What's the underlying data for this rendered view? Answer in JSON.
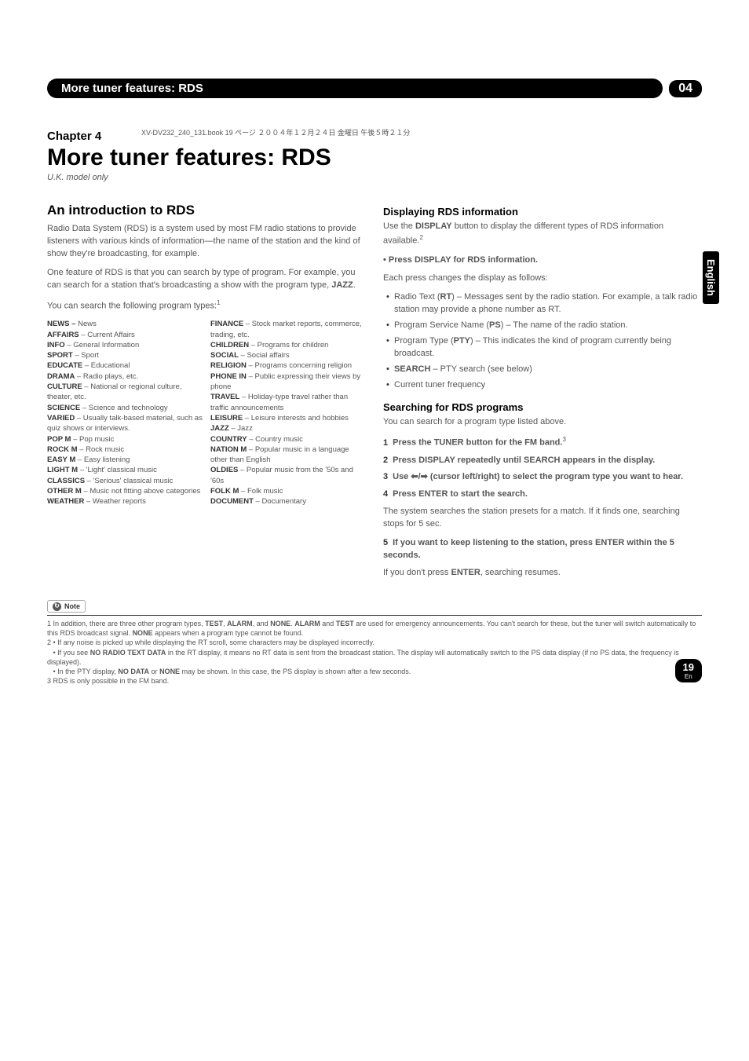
{
  "spine_note": "XV-DV232_240_131.book 19 ページ ２００４年１２月２４日 金曜日 午後５時２１分",
  "header": {
    "title": "More tuner features: RDS",
    "num": "04"
  },
  "side_tab": "English",
  "chapter": {
    "label": "Chapter 4",
    "title": "More tuner features: RDS",
    "subtitle": "U.K. model only"
  },
  "intro": {
    "heading": "An introduction to RDS",
    "p1": "Radio Data System (RDS) is a system used by most FM radio stations to provide listeners with various kinds of information—the name of the station and the kind of show they're broadcasting, for example.",
    "p2_a": "One feature of RDS is that you can search by type of program. For example, you can search for a station that's broadcasting a show with the program type, ",
    "p2_b": "JAZZ",
    "p2_c": ".",
    "p3": "You can search the following program types:",
    "sup1": "1"
  },
  "pt_left": {
    "news_k": "NEWS –",
    "news_v": " News",
    "affairs_k": "AFFAIRS",
    "affairs_v": " – Current Affairs",
    "info_k": "INFO",
    "info_v": " – General Information",
    "sport_k": "SPORT",
    "sport_v": " – Sport",
    "educate_k": "EDUCATE",
    "educate_v": " – Educational",
    "drama_k": "DRAMA",
    "drama_v": " – Radio plays, etc.",
    "culture_k": "CULTURE",
    "culture_v": " – National or regional culture, theater, etc.",
    "science_k": "SCIENCE",
    "science_v": " – Science and technology",
    "varied_k": "VARIED",
    "varied_v": " – Usually talk-based material, such as quiz shows or interviews.",
    "popm_k": "POP M",
    "popm_v": " – Pop music",
    "rockm_k": "ROCK M",
    "rockm_v": " – Rock music",
    "easym_k": "EASY M",
    "easym_v": " – Easy listening",
    "lightm_k": "LIGHT M",
    "lightm_v": " – 'Light' classical music",
    "classics_k": "CLASSICS",
    "classics_v": " – 'Serious' classical music",
    "otherm_k": "OTHER M",
    "otherm_v": " – Music not fitting above categories",
    "weather_k": "WEATHER",
    "weather_v": " – Weather reports"
  },
  "pt_right": {
    "finance_k": "FINANCE",
    "finance_v": " – Stock market reports, commerce, trading, etc.",
    "children_k": "CHILDREN",
    "children_v": " – Programs for children",
    "social_k": "SOCIAL",
    "social_v": " – Social affairs",
    "religion_k": "RELIGION",
    "religion_v": " – Programs concerning religion",
    "phonein_k": "PHONE IN",
    "phonein_v": " – Public expressing their views by phone",
    "travel_k": "TRAVEL",
    "travel_v": " – Holiday-type travel rather than traffic announcements",
    "leisure_k": "LEISURE",
    "leisure_v": " – Leisure interests and hobbies",
    "jazz_k": "JAZZ",
    "jazz_v": " – Jazz",
    "country_k": "COUNTRY",
    "country_v": " – Country music",
    "nationm_k": "NATION M",
    "nationm_v": " – Popular music in a language other than English",
    "oldies_k": "OLDIES",
    "oldies_v": " – Popular music from the '50s and '60s",
    "folkm_k": "FOLK M",
    "folkm_v": " – Folk music",
    "document_k": "DOCUMENT",
    "document_v": " – Documentary"
  },
  "display": {
    "heading": "Displaying RDS information",
    "p1_a": "Use the ",
    "p1_b": "DISPLAY",
    "p1_c": " button to display the different types of RDS information available.",
    "sup2": "2",
    "bullet_main": "Press DISPLAY for RDS information.",
    "sub": "Each press changes the display as follows:",
    "li1_a": "Radio Text (",
    "li1_b": "RT",
    "li1_c": ") – Messages sent by the radio station. For example, a talk radio station may provide a phone number as RT.",
    "li2_a": "Program Service Name (",
    "li2_b": "PS",
    "li2_c": ") – The name of the radio station.",
    "li3_a": "Program Type (",
    "li3_b": "PTY",
    "li3_c": ") – This indicates the kind of program currently being broadcast.",
    "li4_a": "SEARCH",
    "li4_b": " – PTY search (see below)",
    "li5": "Current tuner frequency"
  },
  "search": {
    "heading": "Searching for RDS programs",
    "p1": "You can search for a program type listed above.",
    "s1_n": "1",
    "s1_t": "Press the TUNER button for the FM band.",
    "sup3": "3",
    "s2_n": "2",
    "s2_t": "Press DISPLAY repeatedly until SEARCH appears in the display.",
    "s3_n": "3",
    "s3_a": "Use ",
    "s3_arrows": "⬅/➡",
    "s3_b": " (cursor left/right) to select the program type you want to hear.",
    "s4_n": "4",
    "s4_t": "Press ENTER to start the search.",
    "s4_p": "The system searches the station presets for a match. If it finds one, searching stops for 5 sec.",
    "s5_n": "5",
    "s5_t": "If you want to keep listening to the station, press ENTER within the 5 seconds.",
    "s5_p_a": "If you don't press ",
    "s5_p_b": "ENTER",
    "s5_p_c": ", searching resumes."
  },
  "note": {
    "label": "Note",
    "n1_a": "1 In addition, there are three other program types, ",
    "n1_b": "TEST",
    "n1_c": ", ",
    "n1_d": "ALARM",
    "n1_e": ", and ",
    "n1_f": "NONE",
    "n1_g": ". ",
    "n1_h": "ALARM",
    "n1_i": " and ",
    "n1_j": "TEST",
    "n1_k": " are used for emergency announcements. You can't search for these, but the tuner will switch automatically to this RDS broadcast signal. ",
    "n1_l": "NONE",
    "n1_m": " appears when a program type cannot be found.",
    "n2a": "2 • If any noise is picked up while displaying the RT scroll, some characters may be displayed incorrectly.",
    "n2b_a": "• If you see ",
    "n2b_b": "NO RADIO TEXT DATA",
    "n2b_c": " in the RT display, it means no RT data is sent from the broadcast station. The display will automatically switch to the PS data display (if no PS data, the frequency is displayed).",
    "n2c_a": "• In the PTY display, ",
    "n2c_b": "NO DATA",
    "n2c_c": " or ",
    "n2c_d": "NONE",
    "n2c_e": " may be shown. In this case, the PS display is shown after a few seconds.",
    "n3": "3 RDS is only possible in the FM band."
  },
  "page_num": {
    "num": "19",
    "lang": "En"
  }
}
